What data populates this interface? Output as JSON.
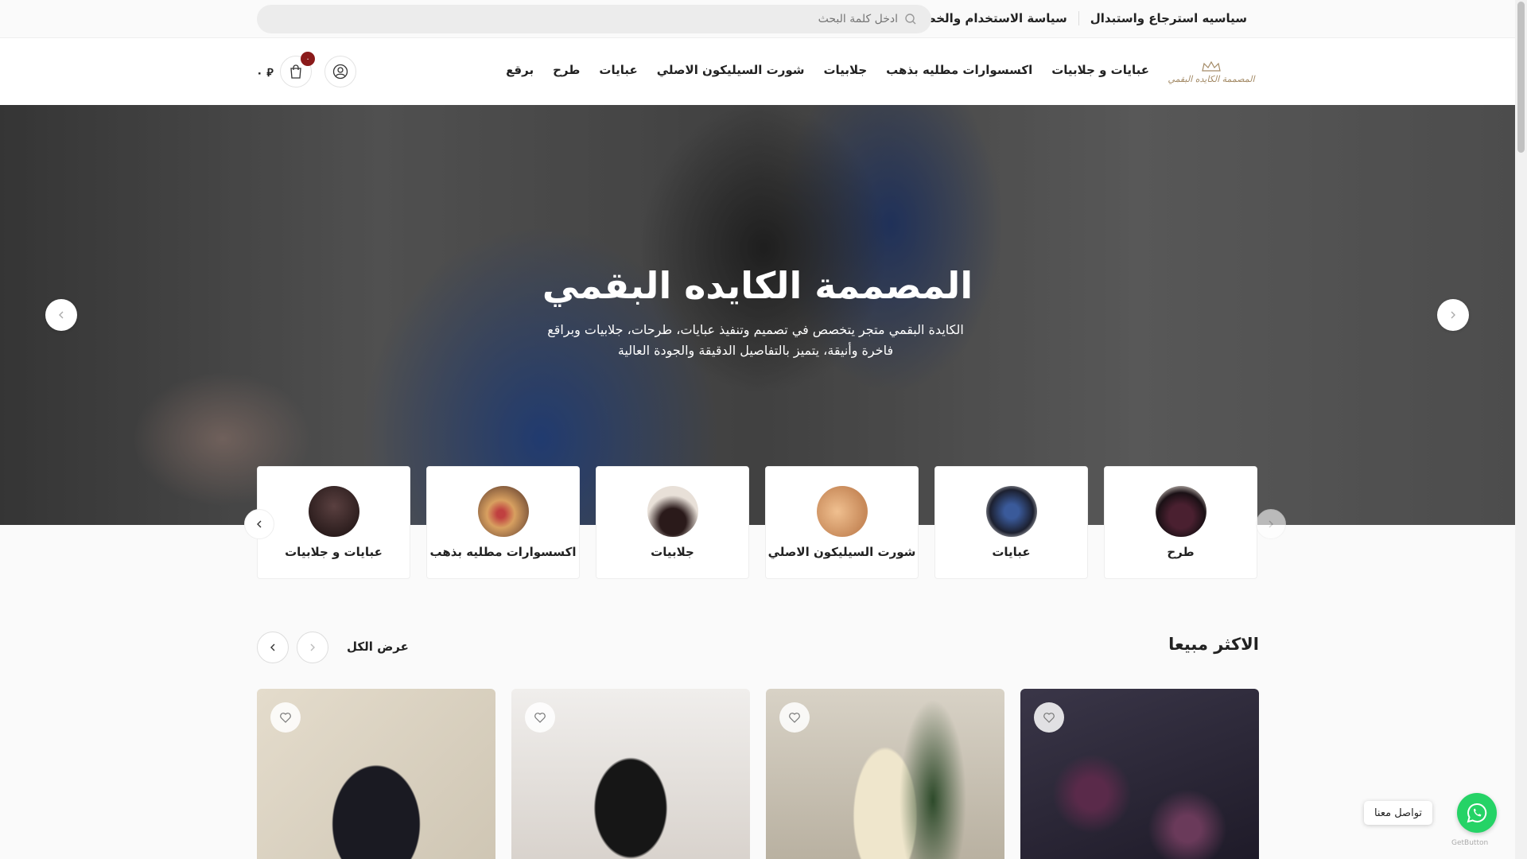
{
  "topbar": {
    "links": [
      "سياسيه استرجاع واستبدال",
      "سياسة الاستخدام والخصوصية"
    ],
    "search_placeholder": "ادخل كلمة البحث"
  },
  "header": {
    "logo_text": "المصممة الكايده البقمي",
    "nav": [
      "عبايات و جلابيات",
      "اكسسوارات مطليه بذهب",
      "جلابيات",
      "شورت السيليكون الاصلي",
      "عبايات",
      "طرح",
      "برقع"
    ],
    "cart_count": "٠",
    "price": "٠ ⃁"
  },
  "hero": {
    "title": "المصممة الكايده البقمي",
    "description": "الكايدة البقمي متجر يتخصص في تصميم وتنفيذ عبايات، طرحات، جلابيات وبراقع فاخرة وأنيقة، يتميز بالتفاصيل الدقيقة والجودة العالية"
  },
  "categories": [
    {
      "label": "عبايات و جلابيات",
      "color": "#2a1d1d"
    },
    {
      "label": "اكسسوارات مطليه بذهب",
      "color": "#b07a4a"
    },
    {
      "label": "جلابيات",
      "color": "#5a3d35"
    },
    {
      "label": "شورت السيليكون الاصلي",
      "color": "#d49a6a"
    },
    {
      "label": "عبايات",
      "color": "#2c3550"
    },
    {
      "label": "طرح",
      "color": "#3a2030"
    }
  ],
  "best_sellers": {
    "title": "الاكثر مبيعا",
    "view_all": "عرض الكل",
    "products": [
      {
        "bg": "#d9d2c3"
      },
      {
        "bg": "#ece8e4"
      },
      {
        "bg": "#c9c1b3"
      },
      {
        "bg": "#2e2a3a"
      }
    ]
  },
  "whatsapp": {
    "label": "تواصل معنا",
    "credit": "GetButton"
  },
  "colors": {
    "accent": "#8a1a1a",
    "whatsapp": "#25d366"
  }
}
